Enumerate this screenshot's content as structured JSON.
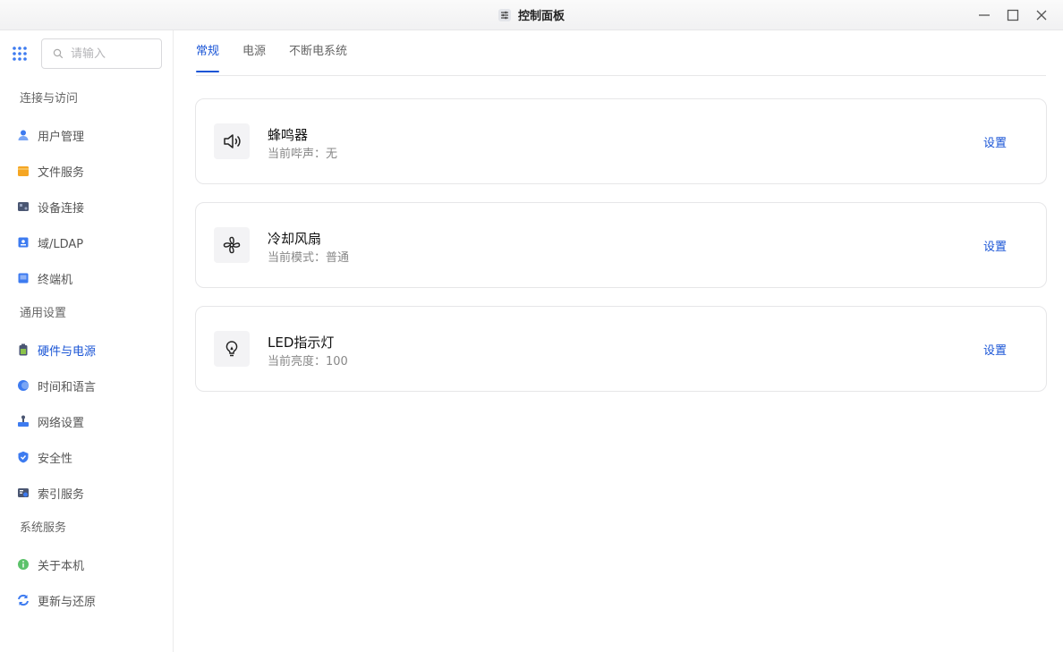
{
  "window": {
    "title": "控制面板",
    "icon": "sliders-icon",
    "controls": [
      "minimize-icon",
      "maximize-icon",
      "close-icon"
    ]
  },
  "sidebar": {
    "apps_icon": "grid-dots-icon",
    "search": {
      "placeholder": "请输入",
      "value": "",
      "icon": "search-icon"
    },
    "groups": [
      {
        "label": "连接与访问",
        "items": [
          {
            "label": "用户管理",
            "icon": "users-icon",
            "color": "#3d7bf0"
          },
          {
            "label": "文件服务",
            "icon": "folder-icon",
            "color": "#f5a623"
          },
          {
            "label": "设备连接",
            "icon": "device-icon",
            "color": "#4a5672"
          },
          {
            "label": "域/LDAP",
            "icon": "directory-icon",
            "color": "#3d7bf0"
          },
          {
            "label": "终端机",
            "icon": "terminal-icon",
            "color": "#3d7bf0"
          }
        ]
      },
      {
        "label": "通用设置",
        "items": [
          {
            "label": "硬件与电源",
            "icon": "battery-icon",
            "color": "#8bc34a",
            "active": true
          },
          {
            "label": "时间和语言",
            "icon": "globe-icon",
            "color": "#3d7bf0"
          },
          {
            "label": "网络设置",
            "icon": "network-icon",
            "color": "#3d7bf0"
          },
          {
            "label": "安全性",
            "icon": "shield-icon",
            "color": "#3d7bf0"
          },
          {
            "label": "索引服务",
            "icon": "index-icon",
            "color": "#4a5672"
          }
        ]
      },
      {
        "label": "系统服务",
        "items": [
          {
            "label": "关于本机",
            "icon": "info-icon",
            "color": "#5cc26a"
          },
          {
            "label": "更新与还原",
            "icon": "sync-icon",
            "color": "#3d7bf0"
          }
        ]
      }
    ]
  },
  "tabs": [
    {
      "label": "常规",
      "active": true
    },
    {
      "label": "电源",
      "active": false
    },
    {
      "label": "不断电系统",
      "active": false
    }
  ],
  "cards": [
    {
      "title": "蜂鸣器",
      "subtitle": "当前哔声：无",
      "action": "设置",
      "icon": "speaker-icon"
    },
    {
      "title": "冷却风扇",
      "subtitle": "当前模式：普通",
      "action": "设置",
      "icon": "fan-icon"
    },
    {
      "title": "LED指示灯",
      "subtitle": "当前亮度：100",
      "action": "设置",
      "icon": "bulb-icon"
    }
  ],
  "colors": {
    "accent": "#1a55d6",
    "border": "#e6e6e8"
  }
}
